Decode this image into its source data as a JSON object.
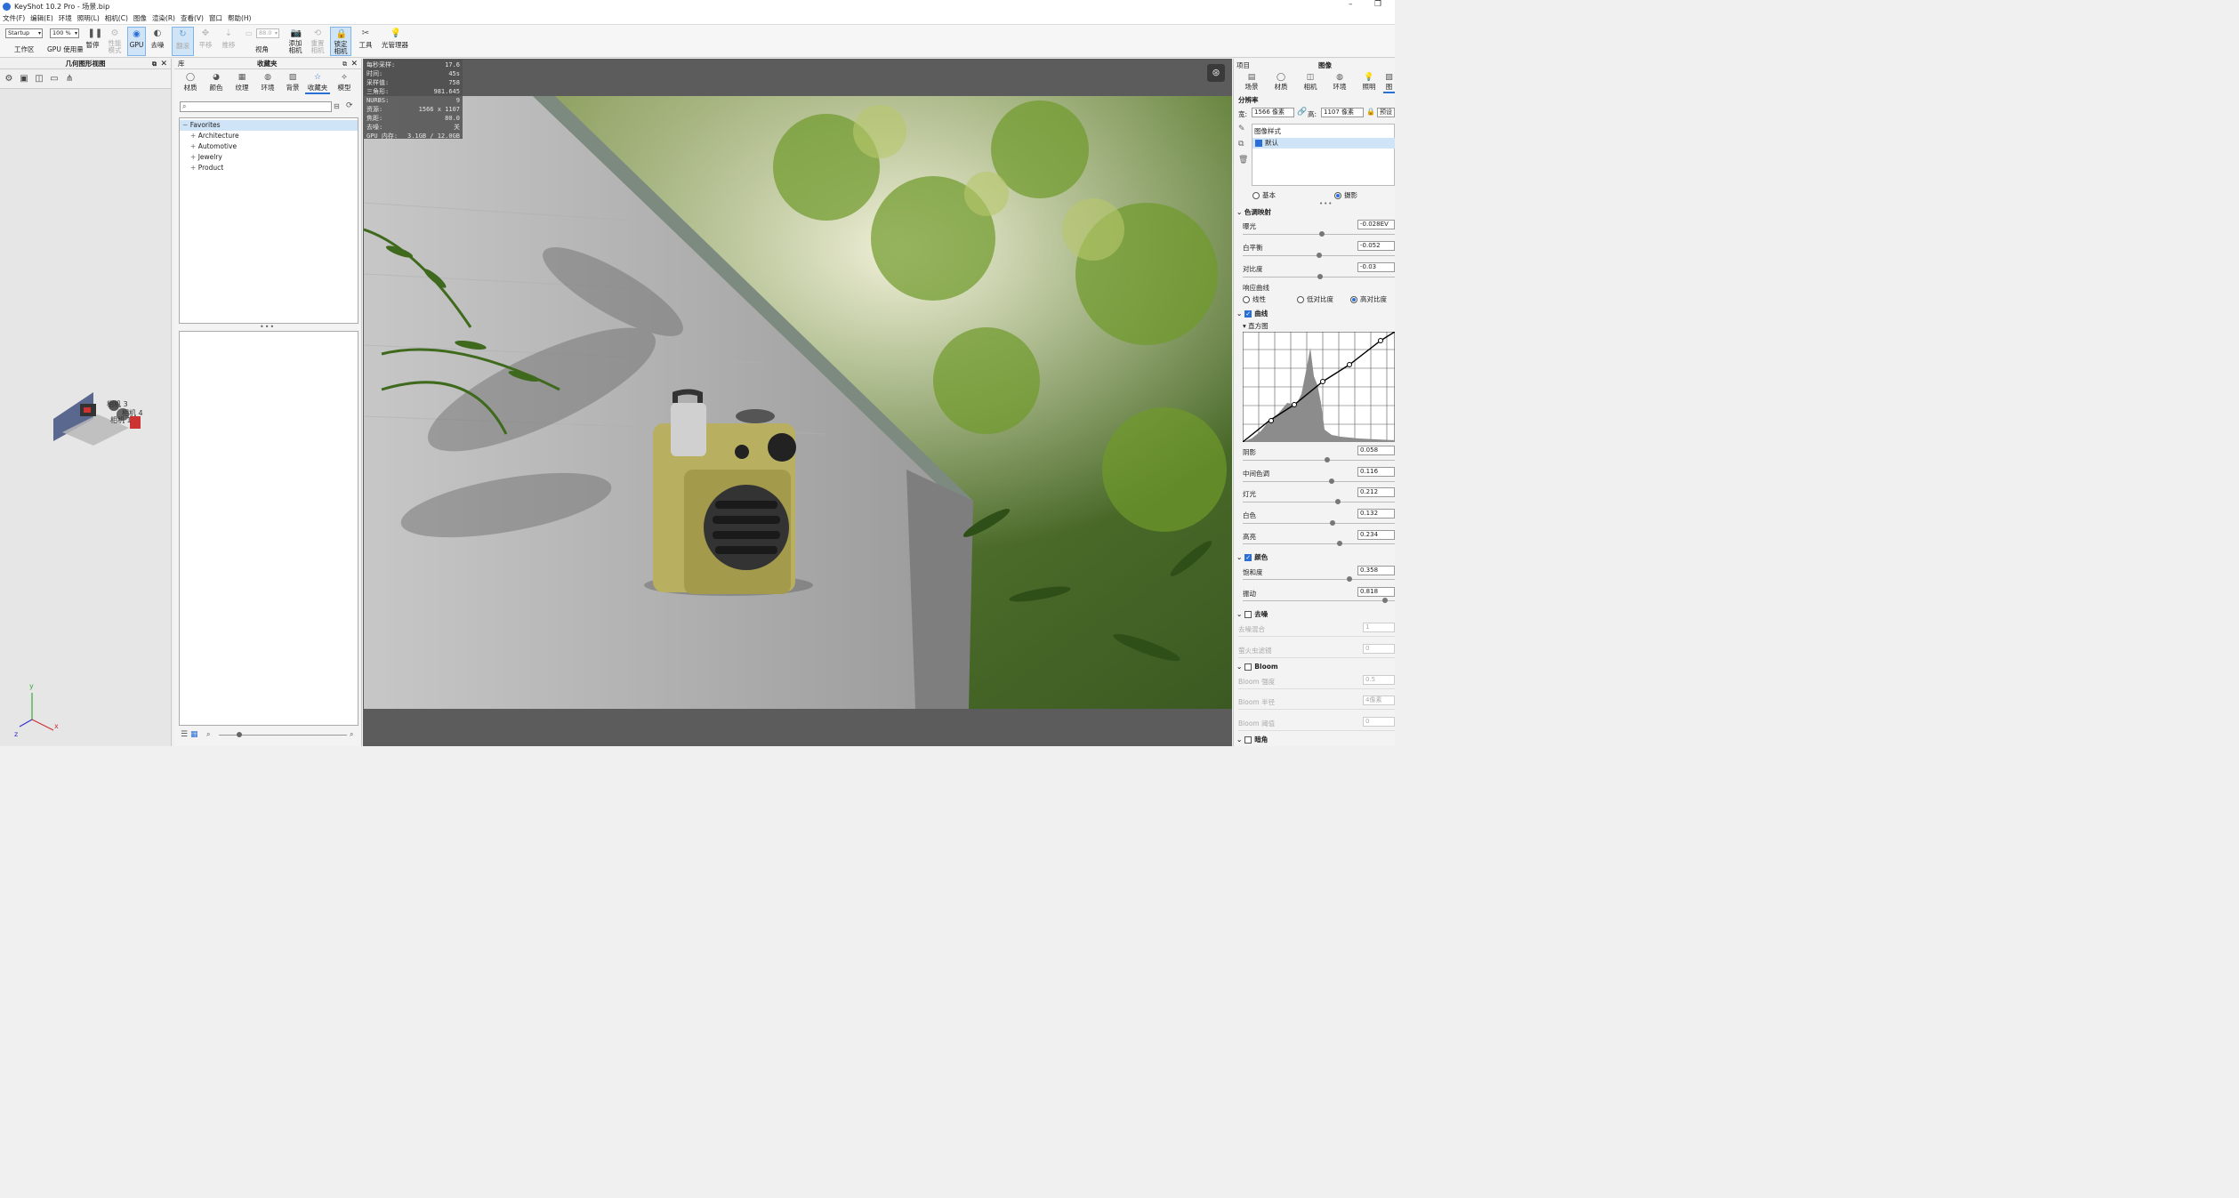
{
  "window": {
    "title": "KeyShot 10.2 Pro  - 场景.bip"
  },
  "menu": [
    "文件(F)",
    "编辑(E)",
    "环境",
    "照明(L)",
    "相机(C)",
    "图像",
    "渲染(R)",
    "查看(V)",
    "窗口",
    "帮助(H)"
  ],
  "toolbar": {
    "workspace_value": "Startup",
    "zoom_value": "100 %",
    "fov_value": "88.0",
    "workspace_label": "工作区",
    "gpu_usage_label": "GPU 使用量",
    "pause_label": "暂停",
    "perf_mode_label": "性能\n模式",
    "gpu_label": "GPU",
    "denoise_label": "去噪",
    "tumble_label": "翻滚",
    "pan_label": "平移",
    "dolly_label": "推移",
    "view_angle_label": "视角",
    "add_camera_label": "添加\n相机",
    "reset_camera_label": "重置\n相机",
    "lock_camera_label": "锁定\n相机",
    "tools_label": "工具",
    "light_manager_label": "光管理器"
  },
  "geometry_panel": {
    "title": "几何图形视图",
    "camera_labels": [
      "相机 3",
      "相机 4",
      "相机 1"
    ],
    "axes": {
      "x": "x",
      "y": "y",
      "z": "z"
    }
  },
  "library": {
    "title": "库",
    "favorites_title": "收藏夹",
    "tabs": [
      {
        "label": "材质",
        "icon": "material-icon"
      },
      {
        "label": "颜色",
        "icon": "color-icon"
      },
      {
        "label": "纹理",
        "icon": "texture-icon"
      },
      {
        "label": "环境",
        "icon": "environment-icon"
      },
      {
        "label": "背景",
        "icon": "background-icon"
      },
      {
        "label": "收藏夹",
        "icon": "favorites-star-icon"
      },
      {
        "label": "模型",
        "icon": "model-icon"
      }
    ],
    "tree": [
      "Favorites",
      "Architecture",
      "Automotive",
      "Jewelry",
      "Product"
    ]
  },
  "stats": [
    [
      "每秒采样:",
      "17.6"
    ],
    [
      "时间:",
      "45s"
    ],
    [
      "采样值:",
      "758"
    ],
    [
      "三角形:",
      "981.645"
    ],
    [
      "NURBS:",
      "9"
    ],
    [
      "资源:",
      "1566 x 1107"
    ],
    [
      "焦距:",
      "80.0"
    ],
    [
      "去噪:",
      "关"
    ],
    [
      "GPU 内存:",
      "3.1GB / 12.0GB"
    ]
  ],
  "project": {
    "title": "项目",
    "panel_title": "图像",
    "tabs": [
      "场景",
      "材质",
      "相机",
      "环境",
      "照明",
      "图"
    ],
    "resolution_label": "分辨率",
    "width_label": "宽:",
    "width_value": "1566 像素",
    "height_label": "高:",
    "height_value": "1107 像素",
    "preset_label": "预设",
    "image_style_label": "图像样式",
    "style_default": "默认",
    "mode_basic": "基本",
    "mode_photo": "摄影",
    "tonemap_label": "色调映射",
    "exposure_label": "曝光",
    "exposure_value": "-0.028EV",
    "white_balance_label": "白平衡",
    "white_balance_value": "-0.052",
    "contrast_label": "对比度",
    "contrast_value": "-0.03",
    "response_curve_label": "响应曲线",
    "curve_linear": "线性",
    "curve_low_contrast": "低对比度",
    "curve_high_contrast": "高对比度",
    "curves_label": "曲线",
    "histogram_label": "直方图",
    "shadows_label": "阴影",
    "shadows_value": "0.058",
    "midtones_label": "中间色调",
    "midtones_value": "0.116",
    "highlights_label": "灯光",
    "highlights_value": "0.212",
    "whites_label": "白色",
    "whites_value": "0.132",
    "brights_label": "高亮",
    "brights_value": "0.234",
    "color_label": "颜色",
    "saturation_label": "饱和度",
    "saturation_value": "0.358",
    "vibrance_label": "振动",
    "vibrance_value": "0.818",
    "denoise_label": "去噪",
    "denoise_blend_label": "去噪混合",
    "denoise_blend_value": "1",
    "firefly_label": "萤火虫滤镜",
    "firefly_value": "0",
    "bloom_label": "Bloom",
    "bloom_intensity_label": "Bloom 强度",
    "bloom_intensity_value": "0.5",
    "bloom_radius_label": "Bloom 半径",
    "bloom_radius_value": "4像素",
    "bloom_threshold_label": "Bloom 阈值",
    "bloom_threshold_value": "0",
    "vignette_label": "暗角"
  },
  "colors": {
    "accent": "#2a6fd6",
    "selection": "#cfe4f7"
  }
}
